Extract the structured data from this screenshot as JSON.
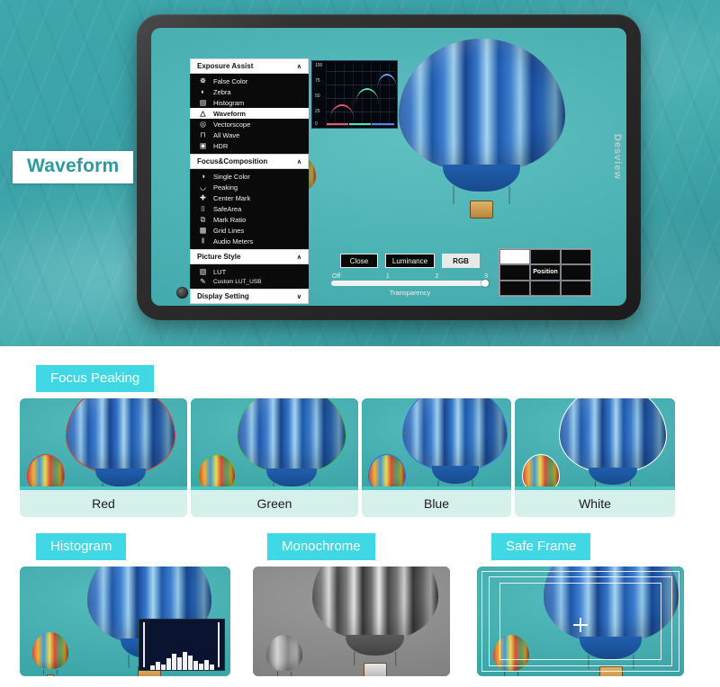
{
  "hero": {
    "badge_label": "Waveform",
    "monitor": {
      "brand": "Desview"
    }
  },
  "osd": {
    "sections": [
      {
        "title": "Exposure Assist",
        "chevron": "∧",
        "items": [
          {
            "label": "False Color",
            "icon": "false-color-icon",
            "glyph": "☸",
            "selected": false
          },
          {
            "label": "Zebra",
            "icon": "zebra-icon",
            "glyph": "◐",
            "selected": false
          },
          {
            "label": "Histogram",
            "icon": "histogram-icon",
            "glyph": "▤",
            "selected": false
          },
          {
            "label": "Waveform",
            "icon": "waveform-icon",
            "glyph": "△",
            "selected": true
          },
          {
            "label": "Vectorscope",
            "icon": "vectorscope-icon",
            "glyph": "◎",
            "selected": false
          },
          {
            "label": "All Wave",
            "icon": "all-wave-icon",
            "glyph": "⊓",
            "selected": false
          },
          {
            "label": "HDR",
            "icon": "hdr-icon",
            "glyph": "▣",
            "selected": false
          }
        ]
      },
      {
        "title": "Focus&Composition",
        "chevron": "∧",
        "items": [
          {
            "label": "Single Color",
            "icon": "single-color-icon",
            "glyph": "◑",
            "selected": false
          },
          {
            "label": "Peaking",
            "icon": "peaking-icon",
            "glyph": "◡",
            "selected": false
          },
          {
            "label": "Center Mark",
            "icon": "center-mark-icon",
            "glyph": "✚",
            "selected": false
          },
          {
            "label": "SafeArea",
            "icon": "safe-area-icon",
            "glyph": "⌷",
            "selected": false
          },
          {
            "label": "Mark Ratio",
            "icon": "mark-ratio-icon",
            "glyph": "⧉",
            "selected": false
          },
          {
            "label": "Grid Lines",
            "icon": "grid-lines-icon",
            "glyph": "▦",
            "selected": false
          },
          {
            "label": "Audio Meters",
            "icon": "audio-meters-icon",
            "glyph": "‖",
            "selected": false
          }
        ]
      },
      {
        "title": "Picture Style",
        "chevron": "∧",
        "items": [
          {
            "label": "LUT",
            "icon": "lut-icon",
            "glyph": "▧",
            "selected": false
          },
          {
            "label": "Custom LUT_USB",
            "icon": "custom-lut-icon",
            "glyph": "✎",
            "selected": false
          }
        ]
      },
      {
        "title": "Display Setting",
        "chevron": "∨",
        "items": []
      }
    ]
  },
  "waveform_widget": {
    "name": "waveform-monitor",
    "scale_labels": [
      "100",
      "75",
      "50",
      "25",
      "0"
    ]
  },
  "osd_controls": {
    "buttons": [
      {
        "label": "Close",
        "active": false
      },
      {
        "label": "Luminance",
        "active": false
      },
      {
        "label": "RGB",
        "active": true
      }
    ],
    "slider": {
      "caption": "Transparency",
      "ticks": [
        "Off",
        "1",
        "2",
        "3"
      ],
      "value": 3
    },
    "position_grid": {
      "label": "Position",
      "active_cell": 0,
      "cells": 9
    }
  },
  "features": {
    "focus_peaking": {
      "badge": "Focus Peaking",
      "items": [
        {
          "caption": "Red",
          "color": "#e03a2f"
        },
        {
          "caption": "Green",
          "color": "#3ec64f"
        },
        {
          "caption": "Blue",
          "color": "#2f6fe0"
        },
        {
          "caption": "White",
          "color": "#ffffff"
        }
      ]
    },
    "histogram": {
      "badge": "Histogram"
    },
    "monochrome": {
      "badge": "Monochrome"
    },
    "safe_frame": {
      "badge": "Safe Frame"
    }
  },
  "colors": {
    "hero_water": "#3fa7ac",
    "badge_cyan": "#3fd8e4",
    "badge_text_teal": "#2e9a9e",
    "caption_mint": "#d6f0ec"
  }
}
